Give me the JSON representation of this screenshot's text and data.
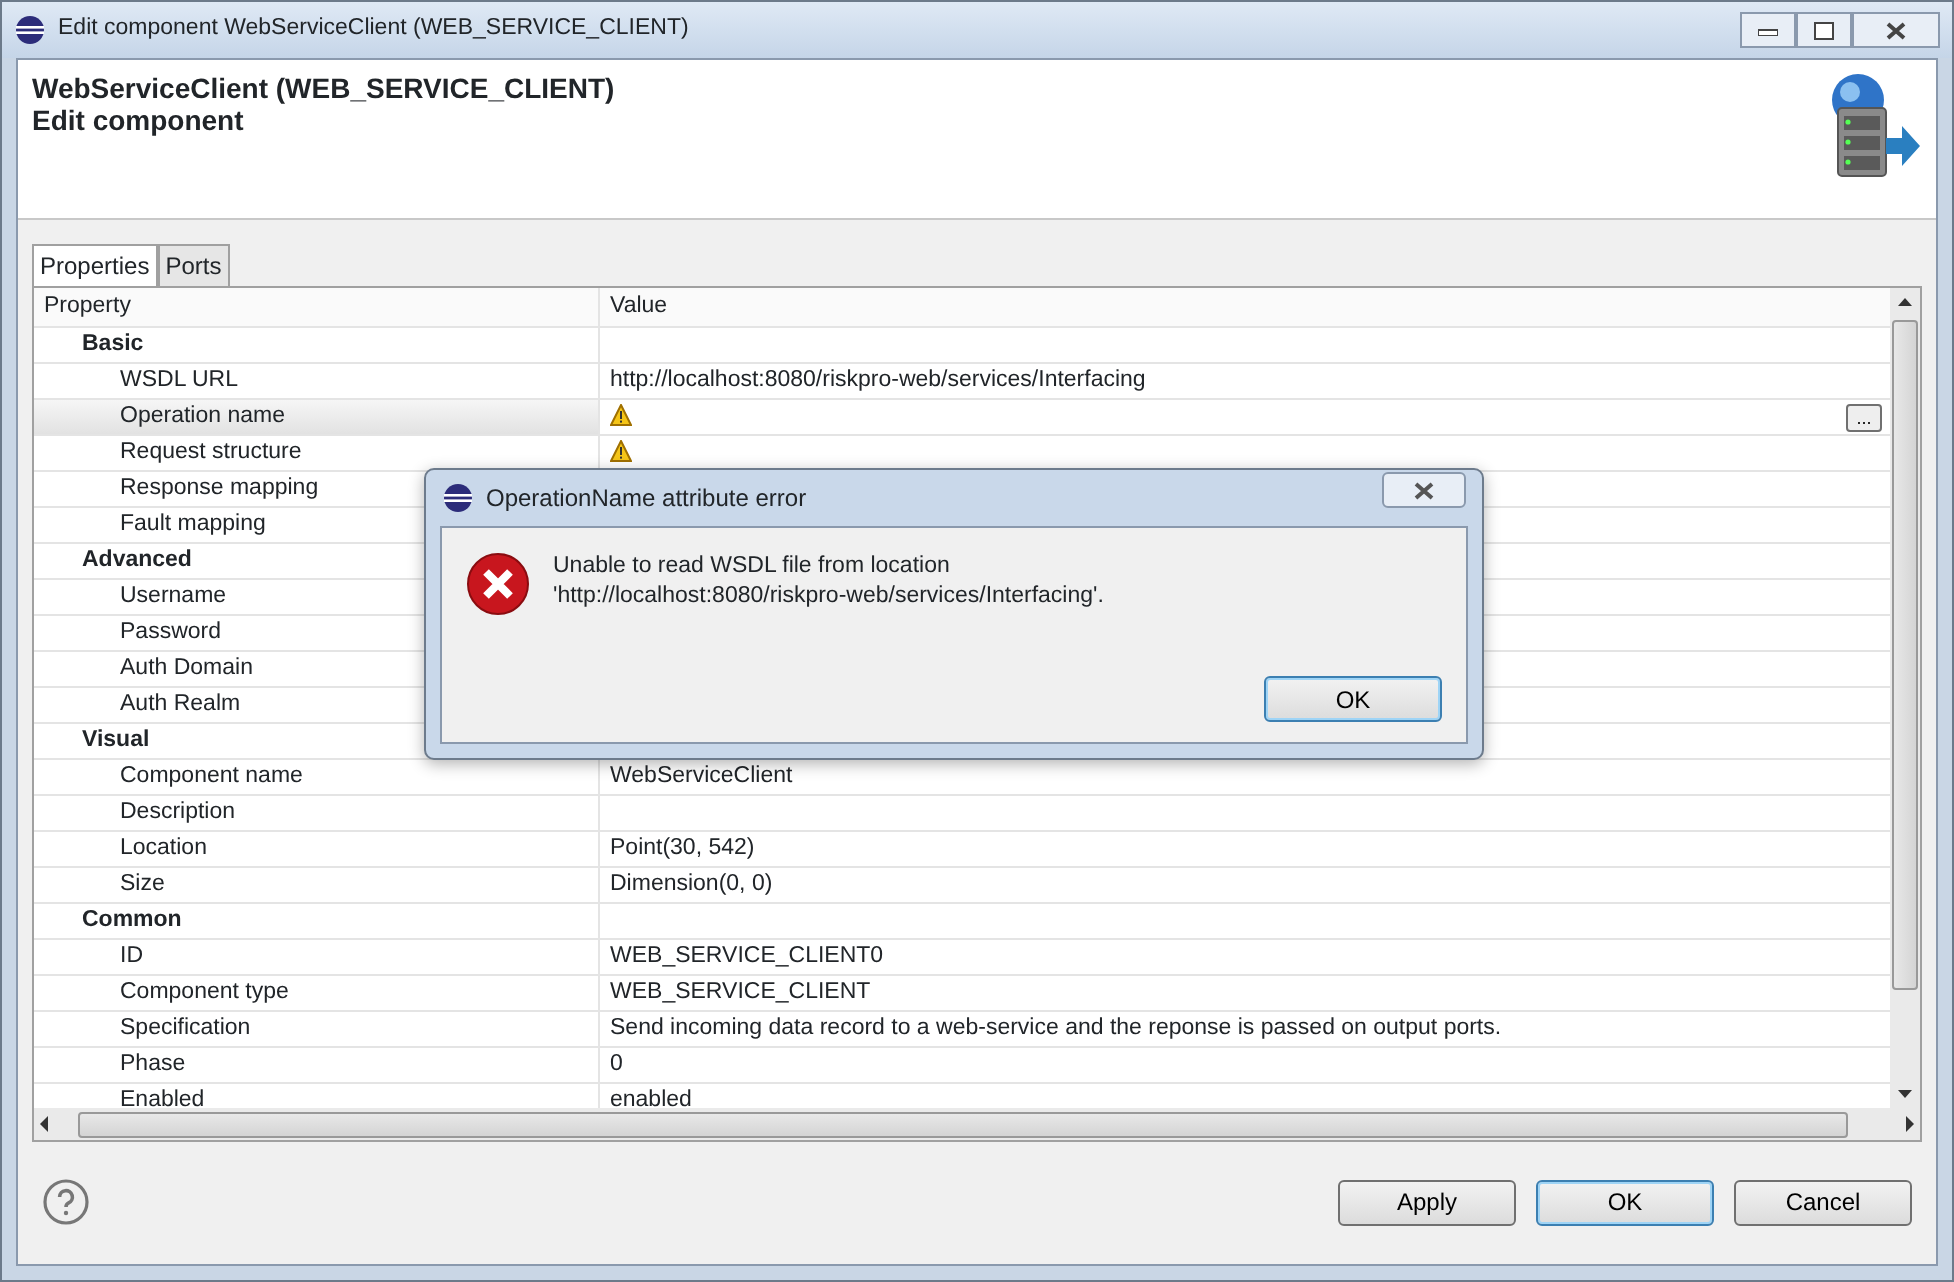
{
  "window": {
    "title": "Edit component WebServiceClient (WEB_SERVICE_CLIENT)"
  },
  "header": {
    "title": "WebServiceClient (WEB_SERVICE_CLIENT)",
    "subtitle": "Edit component"
  },
  "tabs": [
    {
      "label": "Properties",
      "selected": true
    },
    {
      "label": "Ports",
      "selected": false
    }
  ],
  "table": {
    "columns": [
      "Property",
      "Value"
    ],
    "groups": [
      {
        "label": "Basic",
        "children": [
          {
            "name": "WSDL URL",
            "value": "http://localhost:8080/riskpro-web/services/Interfacing",
            "warning": false,
            "selected": false
          },
          {
            "name": "Operation name",
            "warning": true,
            "selected": true,
            "edit_button": "..."
          },
          {
            "name": "Request structure",
            "warning": true,
            "selected": false
          },
          {
            "name": "Response mapping",
            "warning": false,
            "selected": false
          },
          {
            "name": "Fault mapping",
            "warning": false,
            "selected": false
          }
        ]
      },
      {
        "label": "Advanced",
        "children": [
          {
            "name": "Username",
            "warning": false,
            "selected": false
          },
          {
            "name": "Password",
            "warning": false,
            "selected": false
          },
          {
            "name": "Auth Domain",
            "warning": false,
            "selected": false
          },
          {
            "name": "Auth Realm",
            "warning": false,
            "selected": false
          }
        ]
      },
      {
        "label": "Visual",
        "children": [
          {
            "name": "Component name",
            "value": "WebServiceClient",
            "warning": false,
            "selected": false
          },
          {
            "name": "Description",
            "warning": false,
            "selected": false
          },
          {
            "name": "Location",
            "value": "Point(30, 542)",
            "warning": false,
            "selected": false
          },
          {
            "name": "Size",
            "value": "Dimension(0, 0)",
            "warning": false,
            "selected": false
          }
        ]
      },
      {
        "label": "Common",
        "children": [
          {
            "name": "ID",
            "value": "WEB_SERVICE_CLIENT0",
            "warning": false,
            "selected": false
          },
          {
            "name": "Component type",
            "value": "WEB_SERVICE_CLIENT",
            "warning": false,
            "selected": false
          },
          {
            "name": "Specification",
            "value": "Send incoming data record to a web-service and the reponse is passed on output ports.",
            "warning": false,
            "selected": false
          },
          {
            "name": "Phase",
            "value": "0",
            "warning": false,
            "selected": false
          },
          {
            "name": "Enabled",
            "value": "enabled",
            "warning": false,
            "selected": false
          }
        ]
      }
    ]
  },
  "buttons": [
    {
      "label": "Apply",
      "default": false
    },
    {
      "label": "OK",
      "default": true
    },
    {
      "label": "Cancel",
      "default": false
    }
  ],
  "dialog": {
    "title": "OperationName attribute error",
    "message": "Unable to read WSDL file from location\n'http://localhost:8080/riskpro-web/services/Interfacing'.",
    "button": "OK"
  }
}
